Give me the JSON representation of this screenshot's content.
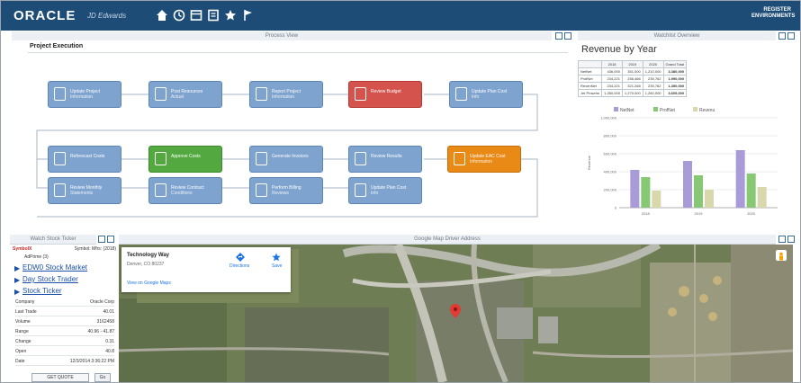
{
  "topbar": {
    "brand": "ORACLE",
    "brand_sub": "JD Edwards",
    "user_line1": "REGISTER",
    "user_line2": "ENVIRONMENTS",
    "colors": {
      "bar": "#1d4c77",
      "accent": "#3a6c9a"
    }
  },
  "process": {
    "pane_label": "Process View",
    "title": "Project Execution",
    "nodes": [
      {
        "id": "n1",
        "label": "Update Project",
        "sub": "Information",
        "color": "blue"
      },
      {
        "id": "n2",
        "label": "Post Resources",
        "sub": "Actual",
        "color": "blue"
      },
      {
        "id": "n3",
        "label": "Report Project",
        "sub": "Information",
        "color": "blue"
      },
      {
        "id": "n4",
        "label": "Review Budget",
        "sub": "",
        "color": "red"
      },
      {
        "id": "n5",
        "label": "Update Plan Cost",
        "sub": "Info",
        "color": "blue"
      },
      {
        "id": "n6",
        "label": "Reforecast Costs",
        "sub": "",
        "color": "blue"
      },
      {
        "id": "n7",
        "label": "Approve Costs",
        "sub": "",
        "color": "green"
      },
      {
        "id": "n8",
        "label": "Generate Invoices",
        "sub": "",
        "color": "blue"
      },
      {
        "id": "n9",
        "label": "Review Results",
        "sub": "",
        "color": "blue"
      },
      {
        "id": "n10",
        "label": "Update EAC Cost",
        "sub": "Information",
        "color": "orange"
      },
      {
        "id": "n11",
        "label": "Review Monthly",
        "sub": "Statements",
        "color": "blue"
      },
      {
        "id": "n12",
        "label": "Review Contract",
        "sub": "Conditions",
        "color": "blue"
      },
      {
        "id": "n13",
        "label": "Perform Billing",
        "sub": "Reviews",
        "color": "blue"
      },
      {
        "id": "n14",
        "label": "Update Plan Cost",
        "sub": "Info",
        "color": "blue"
      }
    ]
  },
  "revenue": {
    "pane_label": "Watchlist Overview",
    "title": "Revenue by Year",
    "table": {
      "columns": [
        "",
        "2018",
        "2019",
        "2020",
        "Grand Total"
      ],
      "rows": [
        [
          "NetNet",
          "436,000",
          "351,000",
          "1,210,000",
          "3,380,000"
        ],
        [
          "ProfNet",
          "234,221",
          "256,466",
          "235,762",
          "1,990,000"
        ],
        [
          "RevenNet",
          "234,221",
          "321,268",
          "235,762",
          "1,350,000"
        ],
        [
          "Jet Prowrim",
          "1,260,000",
          "1,270,000",
          "1,260,000",
          "3,605,000"
        ]
      ]
    }
  },
  "chart_data": {
    "type": "bar",
    "title": "",
    "legend": [
      "NetNet",
      "ProfNet",
      "Revenu"
    ],
    "legend_position": "top",
    "categories": [
      "2018",
      "2019",
      "2020"
    ],
    "ylim": [
      0,
      1000000
    ],
    "yticks": [
      "1,000,000",
      "800,000",
      "600,000",
      "400,000",
      "200,000",
      "0"
    ],
    "series": [
      {
        "name": "NetNet",
        "color": "#a99ad8",
        "values": [
          420000,
          520000,
          640000
        ]
      },
      {
        "name": "ProfNet",
        "color": "#86c873",
        "values": [
          340000,
          360000,
          380000
        ]
      },
      {
        "name": "Revenu",
        "color": "#d9d8ad",
        "values": [
          190000,
          200000,
          230000
        ]
      }
    ],
    "ylabel": "Revenue",
    "grid": true
  },
  "stock": {
    "pane_label": "Watch Stock Ticker",
    "header": "SymbolX",
    "header_right": "Symbol: Mfrs: (2018)",
    "sub": "AdPrime (3)",
    "links": [
      "EDW0 Stock Market",
      "Day Stock Trader",
      "Stock Ticker"
    ],
    "rows": [
      {
        "k": "Company",
        "v": "Oracle Corp"
      },
      {
        "k": "Last Trade",
        "v": "40.01"
      },
      {
        "k": "Volume",
        "v": "3162458"
      },
      {
        "k": "Range",
        "v": "40.96 - 41.87"
      },
      {
        "k": "Change",
        "v": "0.31"
      },
      {
        "k": "Open",
        "v": "40.8"
      },
      {
        "k": "Date",
        "v": "12/3/2014 3:36:22 PM"
      }
    ],
    "quote_btn": "GET QUOTE",
    "go_btn": "Go"
  },
  "map": {
    "pane_label": "Google Map Driver Address",
    "card_title": "Technology Way",
    "card_addr": "Denver, CO 80237",
    "card_link": "View on Google Maps",
    "dir_label": "Directions",
    "save_label": "Save"
  }
}
